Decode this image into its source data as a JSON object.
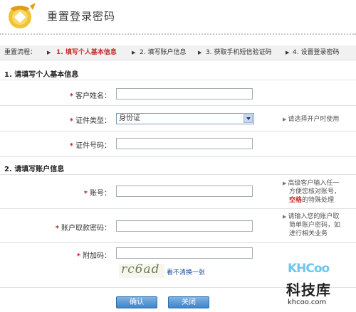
{
  "header": {
    "title": "重置登录密码"
  },
  "steps": {
    "prefix": "重置流程：",
    "items": [
      "1. 填写个人基本信息",
      "2. 填写账户信息",
      "3. 获取手机短信验证码",
      "4. 设置登录密码"
    ],
    "active_index": 0
  },
  "section1": {
    "title": "1. 请填写个人基本信息",
    "name_label": "客户姓名：",
    "name_value": "",
    "id_type_label": "证件类型：",
    "id_type_value": "身份证",
    "id_type_tip": "请选择开户时使用",
    "id_no_label": "证件号码：",
    "id_no_value": ""
  },
  "section2": {
    "title": "2. 请填写账户信息",
    "account_label": "账号：",
    "account_value": "",
    "account_tip_lines": [
      "高级客户输入任一",
      "方便您核对账号，",
      "空格的特殊处理"
    ],
    "account_tip_red": "空格",
    "password_label": "账户取款密码：",
    "password_value": "",
    "password_tip_lines": [
      "请输入您的账户取",
      "简单账户密码，如",
      "进行相关业务"
    ],
    "extra_label": "附加码：",
    "extra_value": "",
    "captcha_text": "rc6ad",
    "refresh_link": "看不清换一张"
  },
  "buttons": {
    "confirm": "确认",
    "close": "关闭"
  },
  "watermark": {
    "brand": "KHCoo",
    "cn": "科技库",
    "url": "khcoo.com"
  },
  "colors": {
    "accent_red": "#c62828",
    "button_blue": "#3f84c8",
    "link_blue": "#1a4fa0"
  }
}
